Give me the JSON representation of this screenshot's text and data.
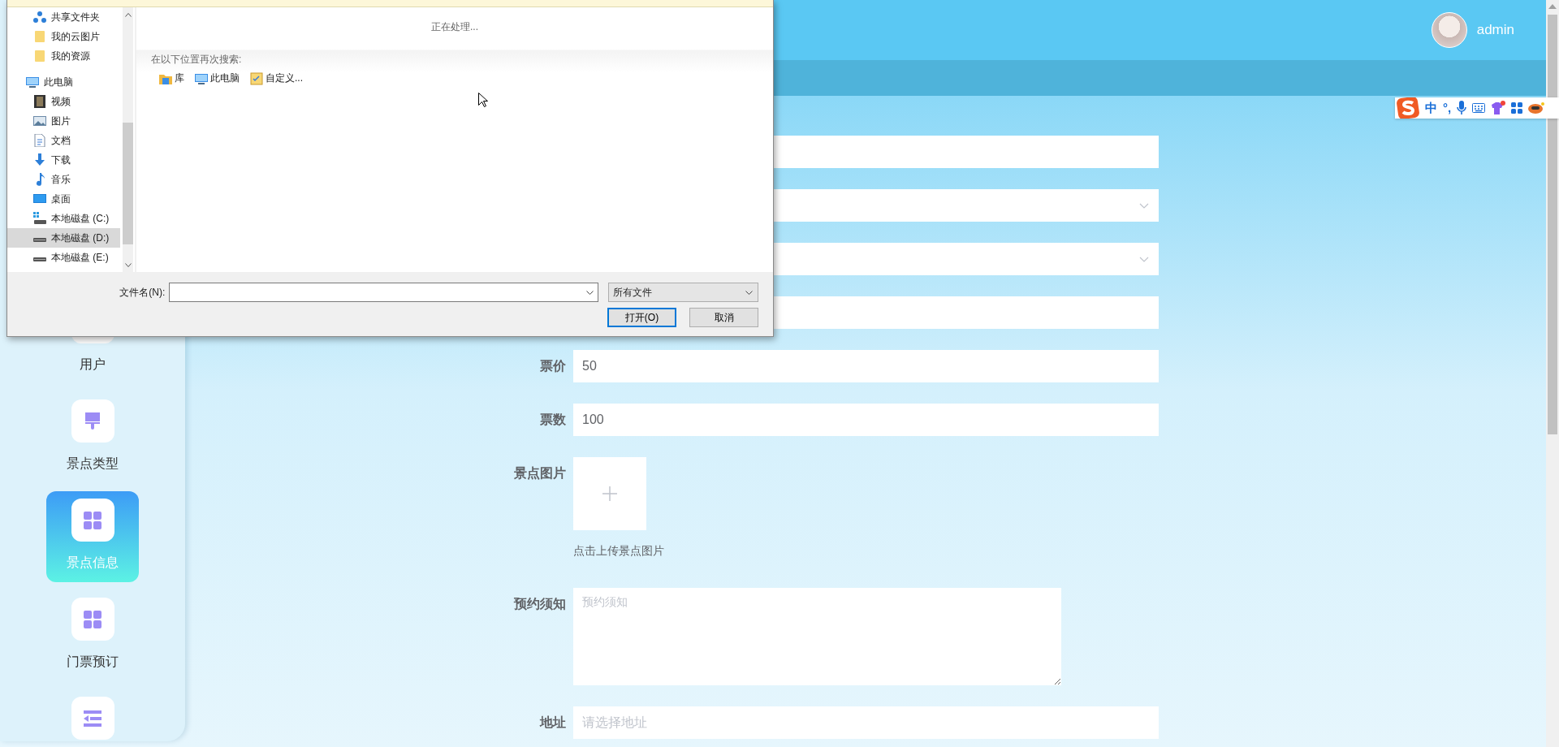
{
  "header": {
    "user": "admin"
  },
  "ime_toolbar": {
    "mode": "中",
    "punctuation": "°,"
  },
  "sidebar": {
    "items": [
      {
        "label": "用户",
        "selected": false
      },
      {
        "label": "景点类型",
        "kind": "brush",
        "selected": false
      },
      {
        "label": "景点信息",
        "kind": "grid",
        "selected": true
      },
      {
        "label": "门票预订",
        "kind": "grid",
        "selected": false
      },
      {
        "kind": "fold",
        "selected": false
      }
    ]
  },
  "form": {
    "rows": [
      {
        "kind": "input"
      },
      {
        "kind": "select"
      },
      {
        "kind": "select"
      },
      {
        "kind": "input"
      },
      {
        "kind": "input",
        "label": "票价",
        "value": "50"
      },
      {
        "kind": "input",
        "label": "票数",
        "value": "100"
      },
      {
        "kind": "upload",
        "label": "景点图片",
        "caption": "点击上传景点图片"
      },
      {
        "kind": "textarea",
        "label": "预约须知",
        "placeholder": "预约须知"
      },
      {
        "kind": "input",
        "label": "地址",
        "placeholder": "请选择地址"
      }
    ]
  },
  "file_dialog": {
    "nav": [
      {
        "children": [
          {
            "label": "共享文件夹",
            "kind": "share",
            "selected": false
          },
          {
            "label": "我的云图片",
            "kind": "folder",
            "selected": false
          },
          {
            "label": "我的资源",
            "kind": "folder",
            "selected": false
          }
        ]
      },
      {
        "label": "此电脑",
        "kind": "pc",
        "selected": false,
        "children": [
          {
            "label": "视频",
            "kind": "video",
            "selected": false
          },
          {
            "label": "图片",
            "kind": "picture",
            "selected": false
          },
          {
            "label": "文档",
            "kind": "doc",
            "selected": false
          },
          {
            "label": "下载",
            "kind": "download",
            "selected": false
          },
          {
            "label": "音乐",
            "kind": "music",
            "selected": false
          },
          {
            "label": "桌面",
            "kind": "desktop",
            "selected": false
          },
          {
            "label": "本地磁盘 (C:)",
            "kind": "sysdrive",
            "selected": false
          },
          {
            "label": "本地磁盘 (D:)",
            "kind": "drive",
            "selected": true
          },
          {
            "label": "本地磁盘 (E:)",
            "kind": "drive",
            "selected": false
          }
        ]
      }
    ],
    "status": "正在处理...",
    "search_again": "在以下位置再次搜索:",
    "locations": [
      {
        "label": "库",
        "kind": "library"
      },
      {
        "label": "此电脑",
        "kind": "pc"
      },
      {
        "label": "自定义...",
        "kind": "custom"
      }
    ],
    "filename_label": "文件名(N):",
    "filter": "所有文件",
    "buttons": [
      {
        "label": "打开(O)",
        "default": true
      },
      {
        "label": "取消",
        "default": false
      }
    ]
  }
}
